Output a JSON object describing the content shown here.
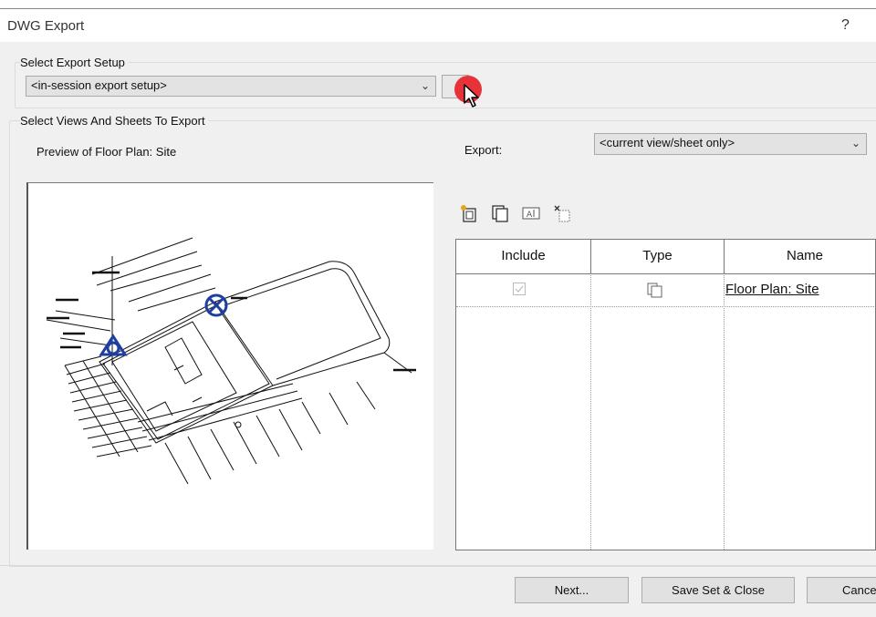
{
  "window": {
    "title": "DWG Export",
    "help_label": "?"
  },
  "export_setup": {
    "group_label": "Select Export Setup",
    "selected": "<in-session export setup>"
  },
  "views": {
    "group_label": "Select Views And Sheets To Export",
    "preview_label": "Preview of Floor Plan: Site",
    "export_label": "Export:",
    "export_selected": "<current view/sheet only>"
  },
  "toolbar_icons": [
    "new-set-icon",
    "duplicate-set-icon",
    "rename-set-icon",
    "delete-set-icon"
  ],
  "table": {
    "columns": [
      "Include",
      "Type",
      "Name"
    ],
    "rows": [
      {
        "include": true,
        "type_icon": "floor-plan-view-icon",
        "name": "Floor Plan: Site"
      }
    ]
  },
  "buttons": {
    "next": "Next...",
    "save_set_close": "Save Set & Close",
    "cancel": "Cance"
  },
  "colors": {
    "cursor_highlight": "#e8323a",
    "marker_blue": "#1f3fa0"
  }
}
